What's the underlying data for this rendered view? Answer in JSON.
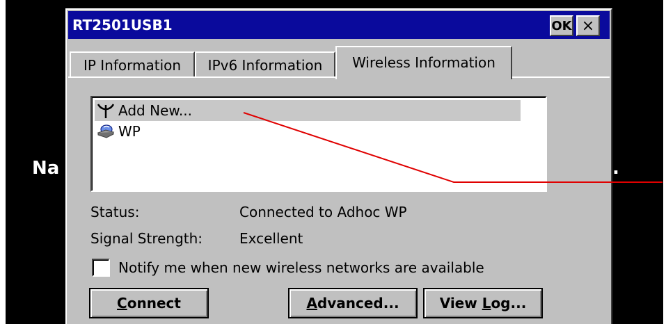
{
  "background": {
    "left_text": "Na",
    "right_text": "."
  },
  "window": {
    "title": "RT2501USB1",
    "ok_label": "OK",
    "close_label": "×"
  },
  "tabs": [
    {
      "label": "IP Information"
    },
    {
      "label": "IPv6 Information"
    },
    {
      "label": "Wireless Information",
      "selected": true
    }
  ],
  "networks": [
    {
      "label": "Add New...",
      "icon": "antenna-icon",
      "selected": true
    },
    {
      "label": "WP",
      "icon": "adhoc-network-icon",
      "selected": false
    }
  ],
  "status": {
    "status_label": "Status:",
    "status_value": "Connected to Adhoc WP",
    "signal_label": "Signal Strength:",
    "signal_value": "Excellent"
  },
  "notify": {
    "label": "Notify me when new wireless networks are available",
    "checked": false
  },
  "buttons": {
    "connect": {
      "accel": "C",
      "rest": "onnect"
    },
    "advanced": {
      "accel": "A",
      "rest": "dvanced..."
    },
    "view_log": {
      "pre": "View ",
      "accel": "L",
      "rest": "og..."
    }
  },
  "colors": {
    "title_bar": "#0a0a9c",
    "dialog_face": "#c0c0c0",
    "annotation_line": "#e00000"
  }
}
